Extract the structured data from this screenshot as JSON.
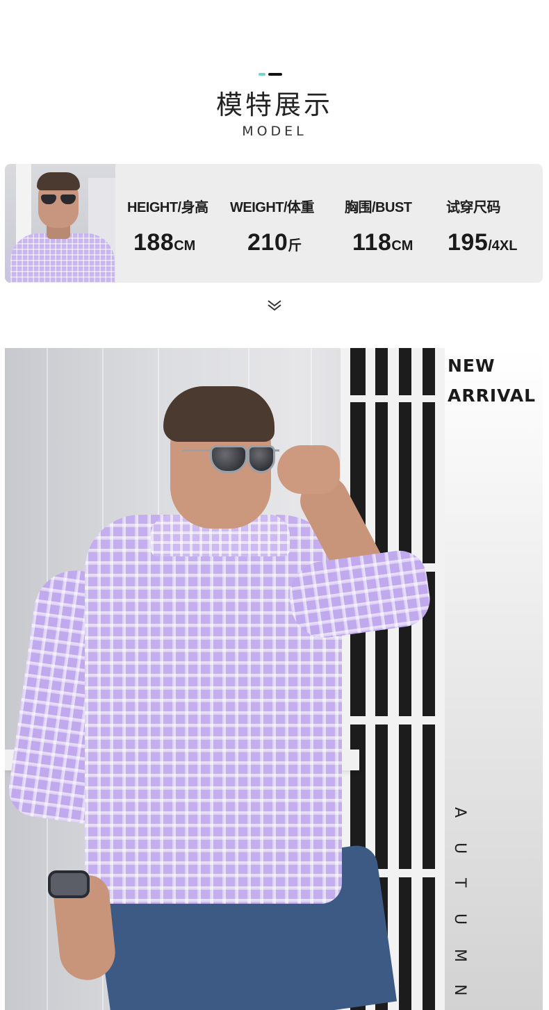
{
  "header": {
    "title_cn": "模特展示",
    "title_en": "MODEL",
    "accent_colors": [
      "#6fd6c7",
      "#111111"
    ]
  },
  "model_stats": {
    "photo_alt": "model-thumbnail",
    "items": [
      {
        "label": "HEIGHT/身高",
        "value": "188",
        "unit": "CM"
      },
      {
        "label": "WEIGHT/体重",
        "value": "210",
        "unit": "斤"
      },
      {
        "label": "胸围/BUST",
        "value": "118",
        "unit": "CM"
      },
      {
        "label": "试穿尺码",
        "value": "195",
        "unit": "/4XL"
      }
    ],
    "card_color": "#ededed"
  },
  "scroll_hint": {
    "icon": "double-chevron-down-icon"
  },
  "hero": {
    "badge_line1": "NEW",
    "badge_line2": "ARRIVAL",
    "vertical_text": [
      "A",
      "U",
      "T",
      "U",
      "M",
      "N"
    ],
    "shirt_color": "#c4aef0"
  }
}
